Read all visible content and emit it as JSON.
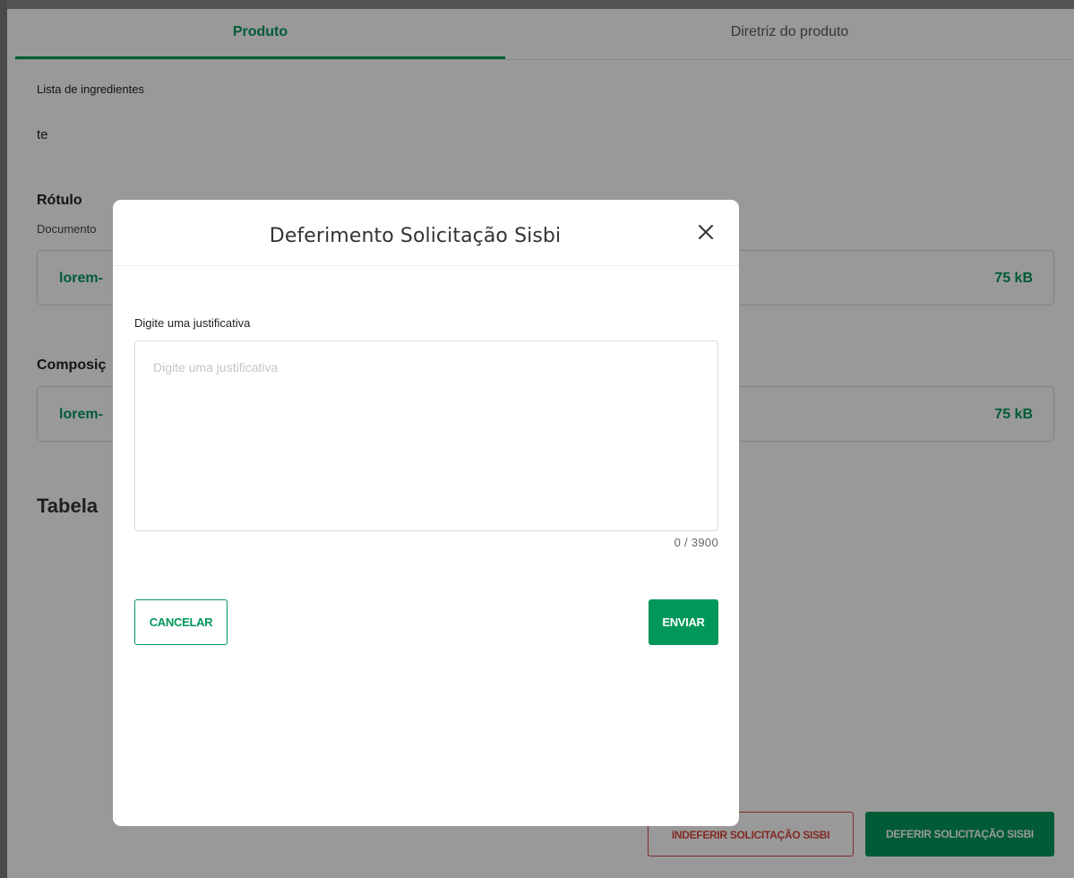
{
  "tabs": {
    "produto": "Produto",
    "diretriz": "Diretriz do produto"
  },
  "page": {
    "ingredientes_label": "Lista de ingredientes",
    "ingredientes_value": "te",
    "rotulo_title": "Rótulo",
    "rotulo_doc_label": "Documento",
    "rotulo_file_name": "lorem-",
    "rotulo_file_size": "75 kB",
    "composicao_title": "Composiç",
    "composicao_file_name": "lorem-",
    "composicao_file_size": "75 kB",
    "tabela_title": "Tabela",
    "indeferir_button": "INDEFERIR SOLICITAÇÃO SISBI",
    "deferir_button": "DEFERIR SOLICITAÇÃO SISBI"
  },
  "modal": {
    "title": "Deferimento Solicitação Sisbi",
    "close_icon": "close-icon",
    "field_label": "Digite uma justificativa",
    "textarea_placeholder": "Digite uma justificativa",
    "textarea_value": "",
    "counter": "0 / 3900",
    "cancel_label": "CANCELAR",
    "submit_label": "ENVIAR"
  },
  "colors": {
    "accent": "#00985a",
    "danger": "#d9463f",
    "overlay": "rgba(0,0,0,0.4)"
  }
}
